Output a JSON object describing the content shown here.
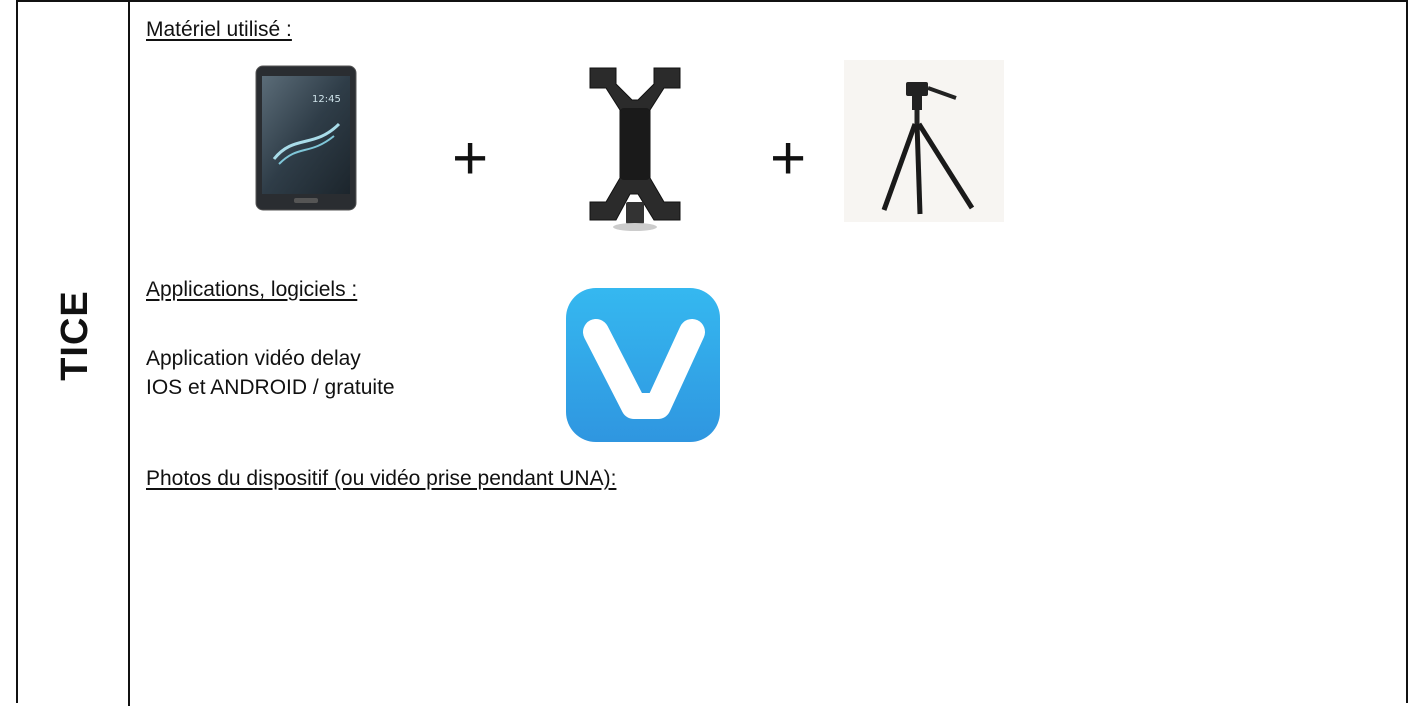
{
  "side_label": "TICE",
  "sections": {
    "materiel_heading": "Matériel utilisé :",
    "applications_heading": "Applications, logiciels :",
    "app_line1": "Application vidéo delay",
    "app_line2": "IOS et ANDROID / gratuite",
    "photos_heading": "Photos du dispositif (ou vidéo prise pendant UNA):"
  },
  "equipment": {
    "separator": "+",
    "items": [
      "tablet-icon",
      "tablet-holder-icon",
      "tripod-icon"
    ]
  },
  "app_icon": {
    "name": "video-delay-app-icon",
    "letter": "V",
    "color": "#3aa7e8"
  }
}
